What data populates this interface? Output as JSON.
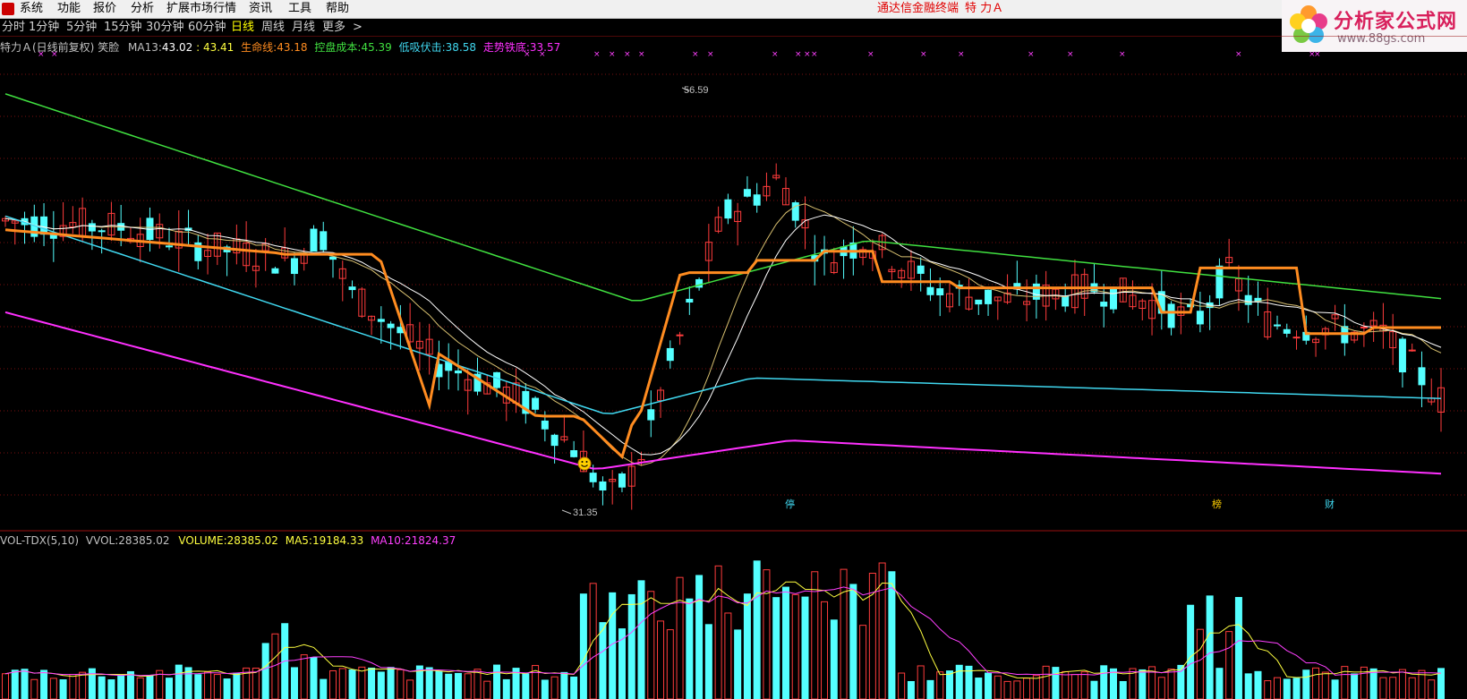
{
  "menubar": {
    "items": [
      "系统",
      "功能",
      "报价",
      "分析",
      "扩展市场行情",
      "资讯",
      "工具",
      "帮助"
    ],
    "title": "通达信金融终端",
    "stock": "特 力Ａ"
  },
  "toolbar": {
    "items": [
      "分时",
      "1分钟",
      "5分钟",
      "15分钟",
      "30分钟",
      "60分钟",
      "日线",
      "周线",
      "月线",
      "更多",
      ">"
    ],
    "selected": "日线"
  },
  "watermark": {
    "title": "分析家公式网",
    "url": "www.88gs.com"
  },
  "main_legend": {
    "stock": "特力Ａ(日线前复权)",
    "indicator": "笑脸",
    "ma13_label": "MA13:",
    "ma13_value": "43.02",
    "extra_value": ": 43.41",
    "life_label": "生命线:",
    "life_value": "43.18",
    "ctrl_label": "控盘成本:",
    "ctrl_value": "45.39",
    "low_label": "低吸伏击:",
    "low_value": "38.58",
    "trend_label": "走势铁底:",
    "trend_value": "33.57"
  },
  "vol_legend": {
    "name": "VOL-TDX(5,10)",
    "vvol_label": "VVOL:",
    "vvol_value": "28385.02",
    "volume_label": "VOLUME:",
    "volume_value": "28385.02",
    "ma5_label": "MA5:",
    "ma5_value": "19184.33",
    "ma10_label": "MA10:",
    "ma10_value": "21824.37"
  },
  "annotations": {
    "high_label": "56.59",
    "low_label": "31.35",
    "event_markers": [
      "停",
      "榜",
      "财"
    ],
    "smiley_icon": "smiley-face-icon"
  },
  "colors": {
    "up": "#ff3c3c",
    "down": "#54ffff",
    "ma13": "#ffffff",
    "life_line": "#ff8c20",
    "ctrl_cost": "#40e040",
    "low_buy": "#40d8f0",
    "trend_bottom": "#ff30ff",
    "vol_ma5": "#ffff40",
    "vol_ma10": "#ff40ff"
  },
  "chart_data": {
    "type": "candlestick",
    "price_range": [
      29.9,
      62.3
    ],
    "high": 56.59,
    "low": 31.35,
    "grid": false,
    "last": {
      "ma13": 43.02,
      "life_line": 43.18,
      "ctrl_cost": 45.39,
      "low_buy": 38.58,
      "trend_bottom": 33.57,
      "volume": 28385.02,
      "vol_ma5": 19184.33,
      "vol_ma10": 21824.37
    }
  }
}
